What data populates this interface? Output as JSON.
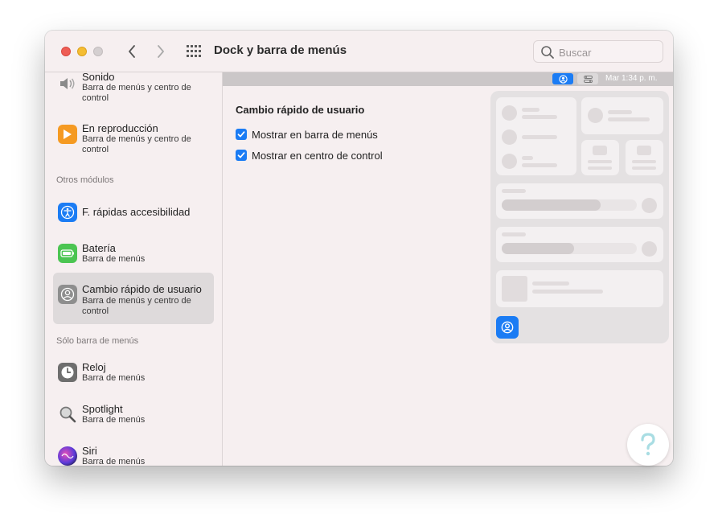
{
  "window": {
    "title": "Dock y barra de menús"
  },
  "search": {
    "placeholder": "Buscar"
  },
  "sidebar": {
    "items": [
      {
        "name": "Sonido",
        "sub": "Barra de menús y centro de control",
        "icon": "speaker-icon"
      },
      {
        "name": "En reproducción",
        "sub": "Barra de menús y centro de control",
        "icon": "play-icon"
      },
      {
        "name": "F. rápidas accesibilidad",
        "sub": "",
        "icon": "accessibility-icon"
      },
      {
        "name": "Batería",
        "sub": "Barra de menús",
        "icon": "battery-icon"
      },
      {
        "name": "Cambio rápido de usuario",
        "sub": "Barra de menús y centro de control",
        "icon": "user-icon"
      },
      {
        "name": "Reloj",
        "sub": "Barra de menús",
        "icon": "clock-icon"
      },
      {
        "name": "Spotlight",
        "sub": "Barra de menús",
        "icon": "magnifier-icon"
      },
      {
        "name": "Siri",
        "sub": "Barra de menús",
        "icon": "siri-icon"
      }
    ],
    "sections": {
      "other": "Otros módulos",
      "menubar_only": "Sólo barra de menús"
    },
    "selected": "Cambio rápido de usuario"
  },
  "main": {
    "menubar_time": "Mar 1:34 p. m.",
    "heading": "Cambio rápido de usuario",
    "options": [
      {
        "label": "Mostrar en barra de menús",
        "checked": true
      },
      {
        "label": "Mostrar en centro de control",
        "checked": true
      }
    ]
  },
  "colors": {
    "accent": "#1b7cf4",
    "window_bg": "#f6eff0"
  }
}
